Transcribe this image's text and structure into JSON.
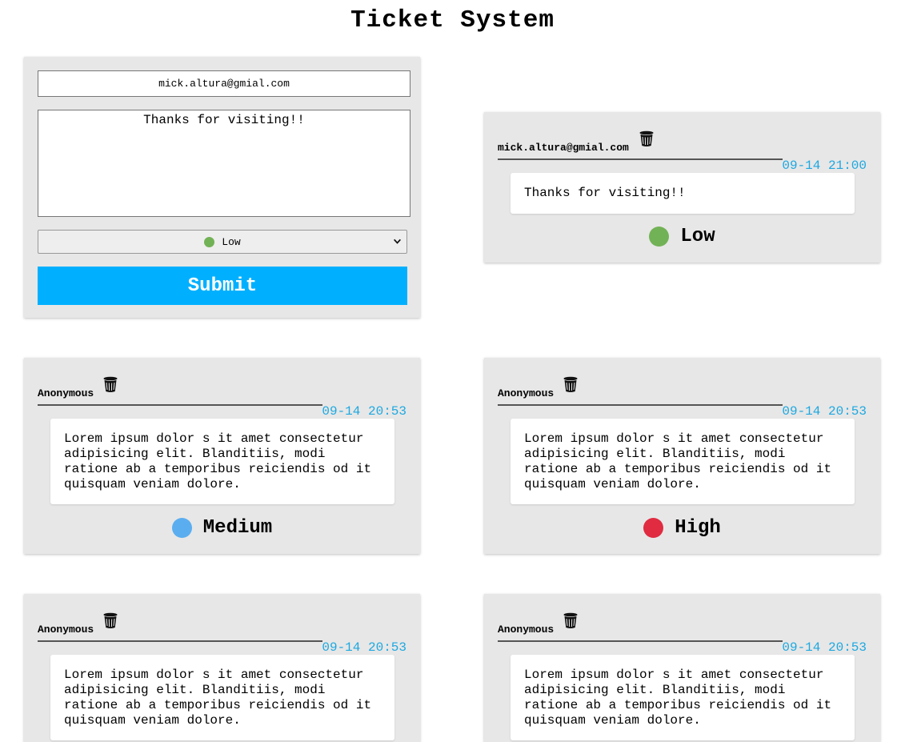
{
  "page": {
    "title": "Ticket System"
  },
  "colors": {
    "accent": "#00b0ff",
    "timestamp": "#1ea8e0",
    "card_bg": "#e7e7e7",
    "low": "#72b256",
    "medium": "#5aaef0",
    "high": "#e02b41"
  },
  "form": {
    "email_value": "mick.altura@gmial.com",
    "message_value": "Thanks for visiting!!",
    "priority_selected": "Low",
    "priority_icon": "green-circle",
    "submit_label": "Submit"
  },
  "tickets": [
    {
      "author": "mick.altura@gmial.com",
      "time": "09-14 21:00",
      "message": "Thanks for visiting!!",
      "priority": "Low",
      "delete_icon": "trash-icon"
    },
    {
      "author": "Anonymous",
      "time": "09-14 20:53",
      "message": "Lorem ipsum dolor s it amet consectetur adipisicing elit. Blanditiis, modi ratione ab a temporibus reiciendis od it quisquam veniam dolore.",
      "priority": "Medium",
      "delete_icon": "trash-icon"
    },
    {
      "author": "Anonymous",
      "time": "09-14 20:53",
      "message": "Lorem ipsum dolor s it amet consectetur adipisicing elit. Blanditiis, modi ratione ab a temporibus reiciendis od it quisquam veniam dolore.",
      "priority": "High",
      "delete_icon": "trash-icon"
    },
    {
      "author": "Anonymous",
      "time": "09-14 20:53",
      "message": "Lorem ipsum dolor s it amet consectetur adipisicing elit. Blanditiis, modi ratione ab a temporibus reiciendis od it quisquam veniam dolore.",
      "priority": "",
      "delete_icon": "trash-icon"
    },
    {
      "author": "Anonymous",
      "time": "09-14 20:53",
      "message": "Lorem ipsum dolor s it amet consectetur adipisicing elit. Blanditiis, modi ratione ab a temporibus reiciendis od it quisquam veniam dolore.",
      "priority": "",
      "delete_icon": "trash-icon"
    }
  ]
}
